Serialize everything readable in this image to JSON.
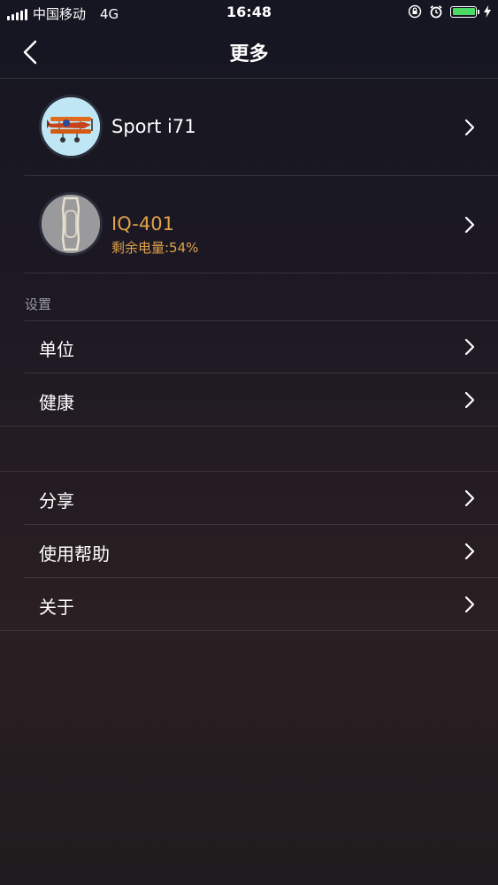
{
  "status_bar": {
    "carrier": "中国移动",
    "network": "4G",
    "time": "16:48",
    "battery_level": 1.0,
    "battery_color": "#4cd964"
  },
  "nav": {
    "title": "更多",
    "back_icon": "chevron-left-icon"
  },
  "devices": [
    {
      "name": "Sport i71",
      "subtitle": "",
      "avatar": "biplane-image",
      "name_color": "#ffffff"
    },
    {
      "name": "IQ-401",
      "subtitle": "剩余电量:54%",
      "avatar": "band-image",
      "name_color": "#e0a24a"
    }
  ],
  "settings": {
    "section_label": "设置",
    "items": [
      {
        "label": "单位"
      },
      {
        "label": "健康"
      }
    ]
  },
  "more": {
    "items": [
      {
        "label": "分享"
      },
      {
        "label": "使用帮助"
      },
      {
        "label": "关于"
      }
    ]
  },
  "accent_color": "#e0a24a"
}
